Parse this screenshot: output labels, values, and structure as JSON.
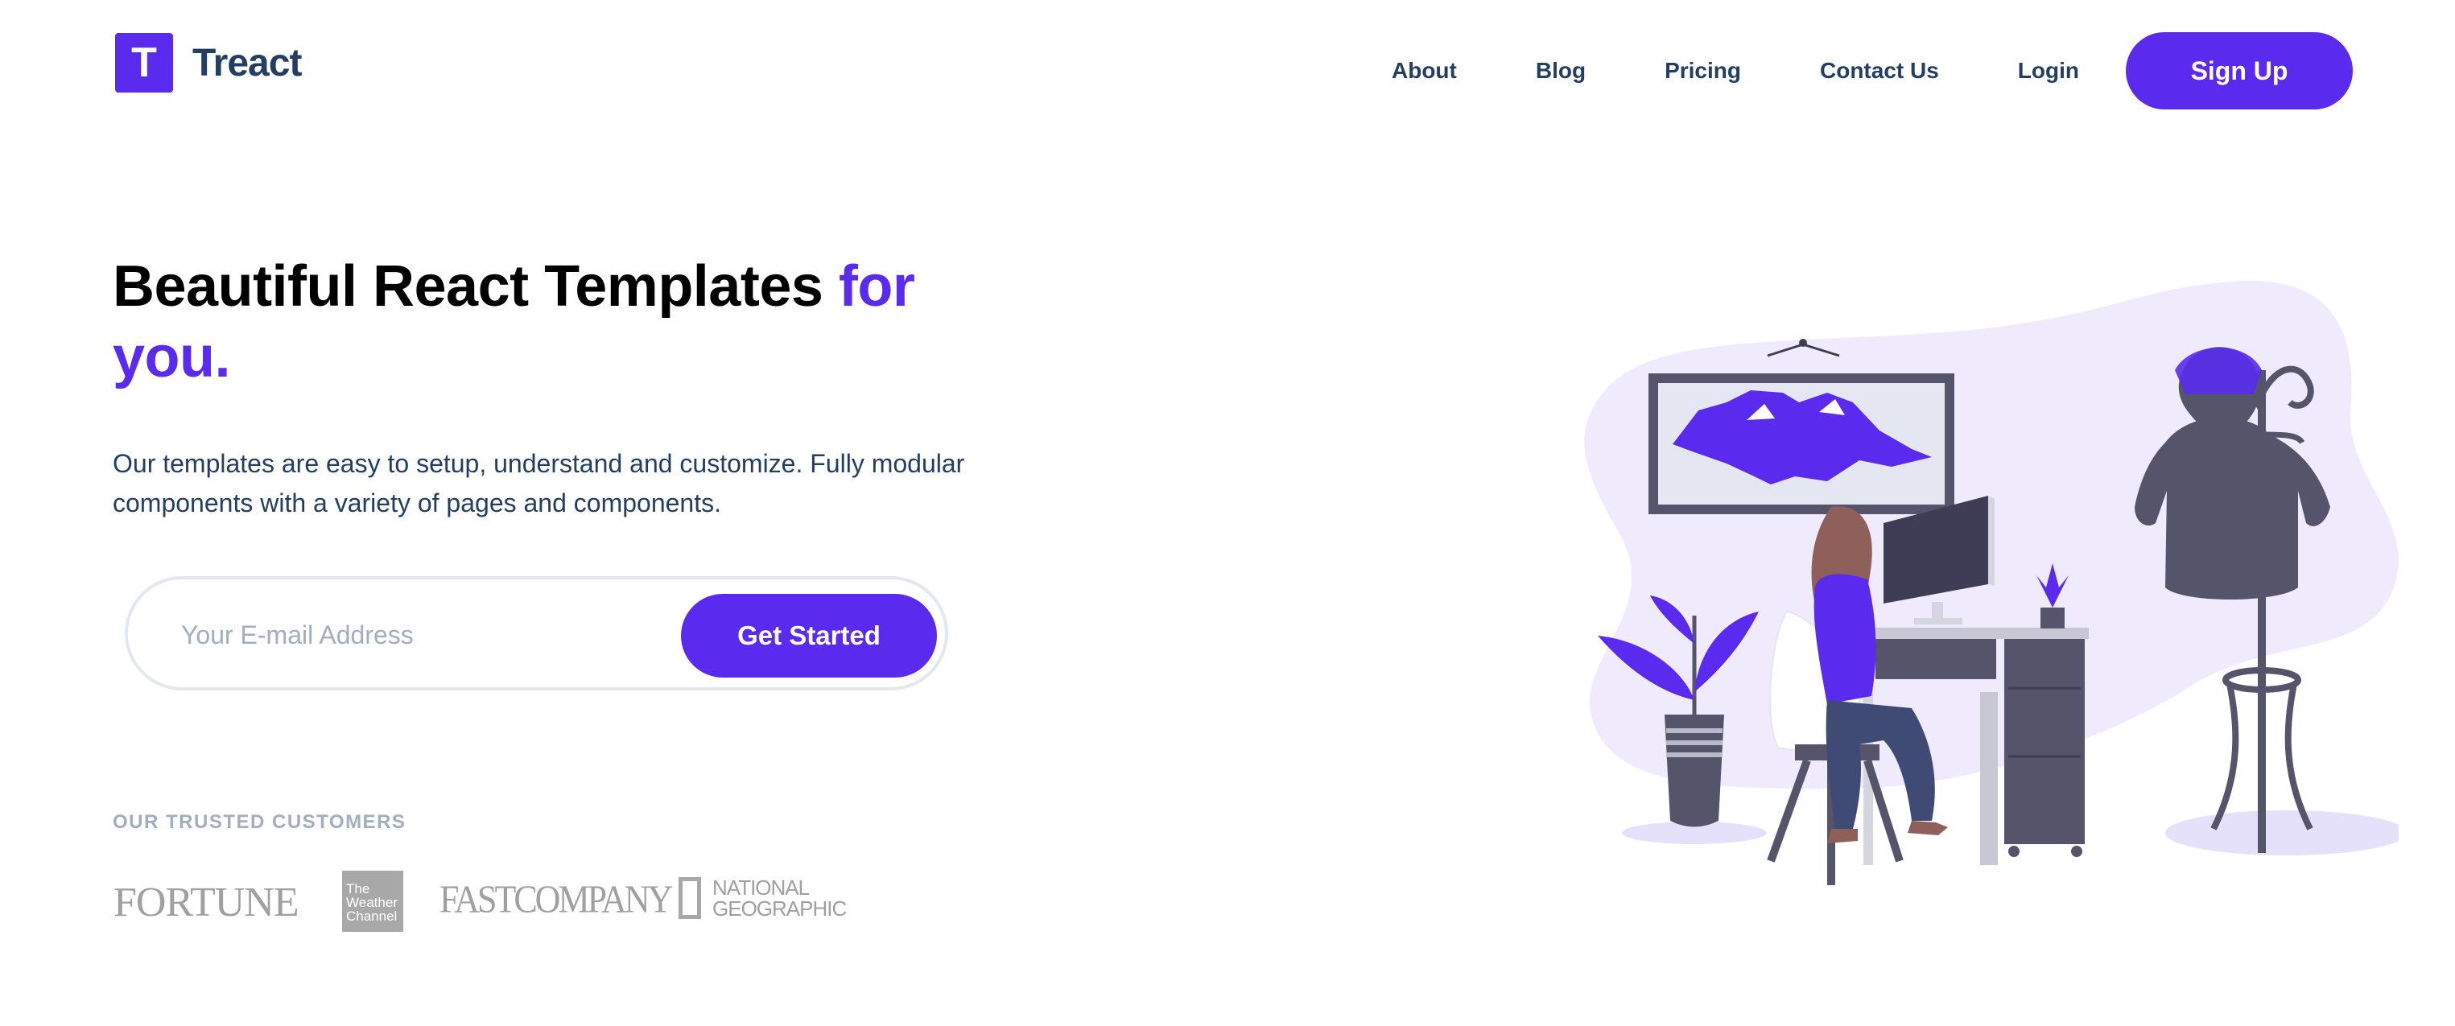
{
  "header": {
    "logo_letter": "T",
    "brand_name": "Treact",
    "nav": [
      "About",
      "Blog",
      "Pricing",
      "Contact Us",
      "Login"
    ],
    "signup_label": "Sign Up"
  },
  "hero": {
    "heading_main": "Beautiful React Templates ",
    "heading_accent": "for you.",
    "description": "Our templates are easy to setup, understand and customize. Fully modular components with a variety of pages and components.",
    "email_placeholder": "Your E-mail Address",
    "cta_label": "Get Started"
  },
  "customers": {
    "title": "OUR TRUSTED CUSTOMERS",
    "logos": {
      "fortune": "FORTUNE",
      "weather_lines": [
        "The",
        "Weather",
        "Channel"
      ],
      "fast_company": "FASTCOMPANY",
      "nat_geo_lines": [
        "NATIONAL",
        "GEOGRAPHIC"
      ]
    }
  },
  "colors": {
    "primary": "#5a2bef",
    "heading_text": "#243e63",
    "muted": "#a0aec0",
    "illustration_bg": "#efebfd"
  }
}
